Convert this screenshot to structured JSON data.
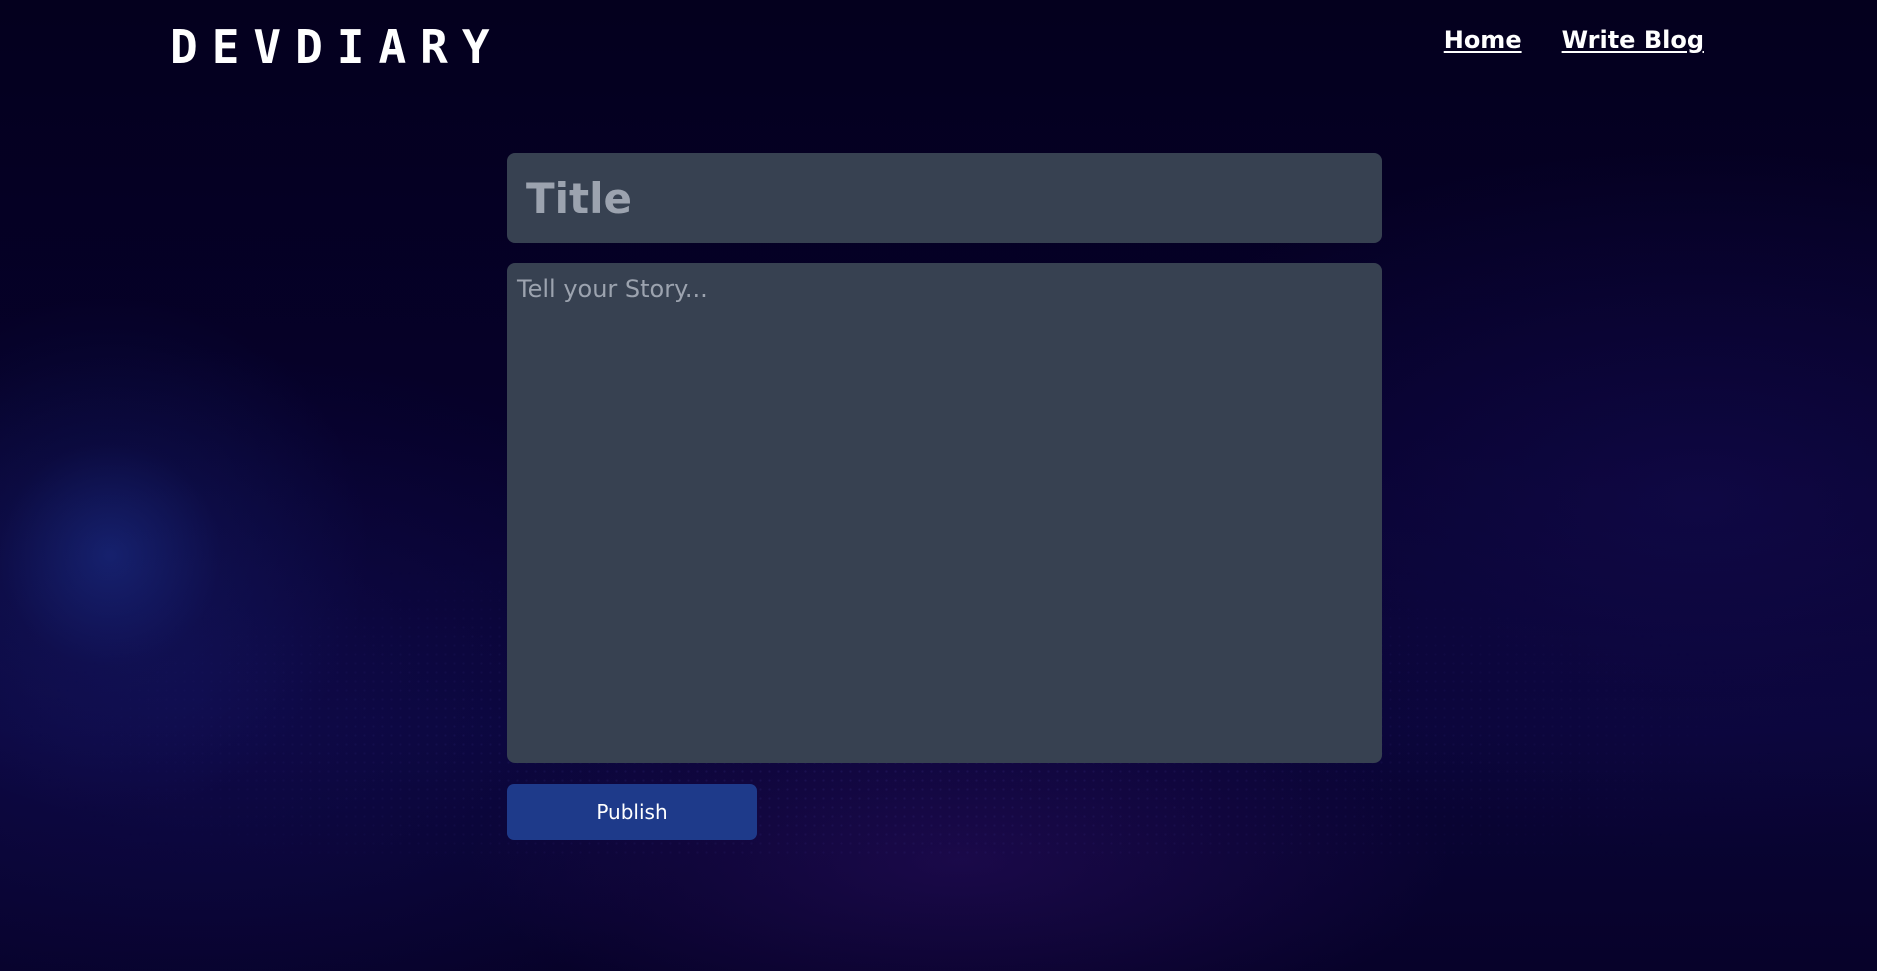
{
  "header": {
    "logo_text": "DEVDIARY",
    "nav": {
      "home_label": "Home",
      "write_blog_label": "Write Blog"
    }
  },
  "editor": {
    "title_value": "",
    "title_placeholder": "Title",
    "story_value": "",
    "story_placeholder": "Tell your Story...",
    "publish_label": "Publish"
  },
  "colors": {
    "background": "#04001e",
    "input_background": "#374151",
    "placeholder": "#9ca3af",
    "publish_button": "#1e3a8a",
    "text": "#ffffff"
  }
}
